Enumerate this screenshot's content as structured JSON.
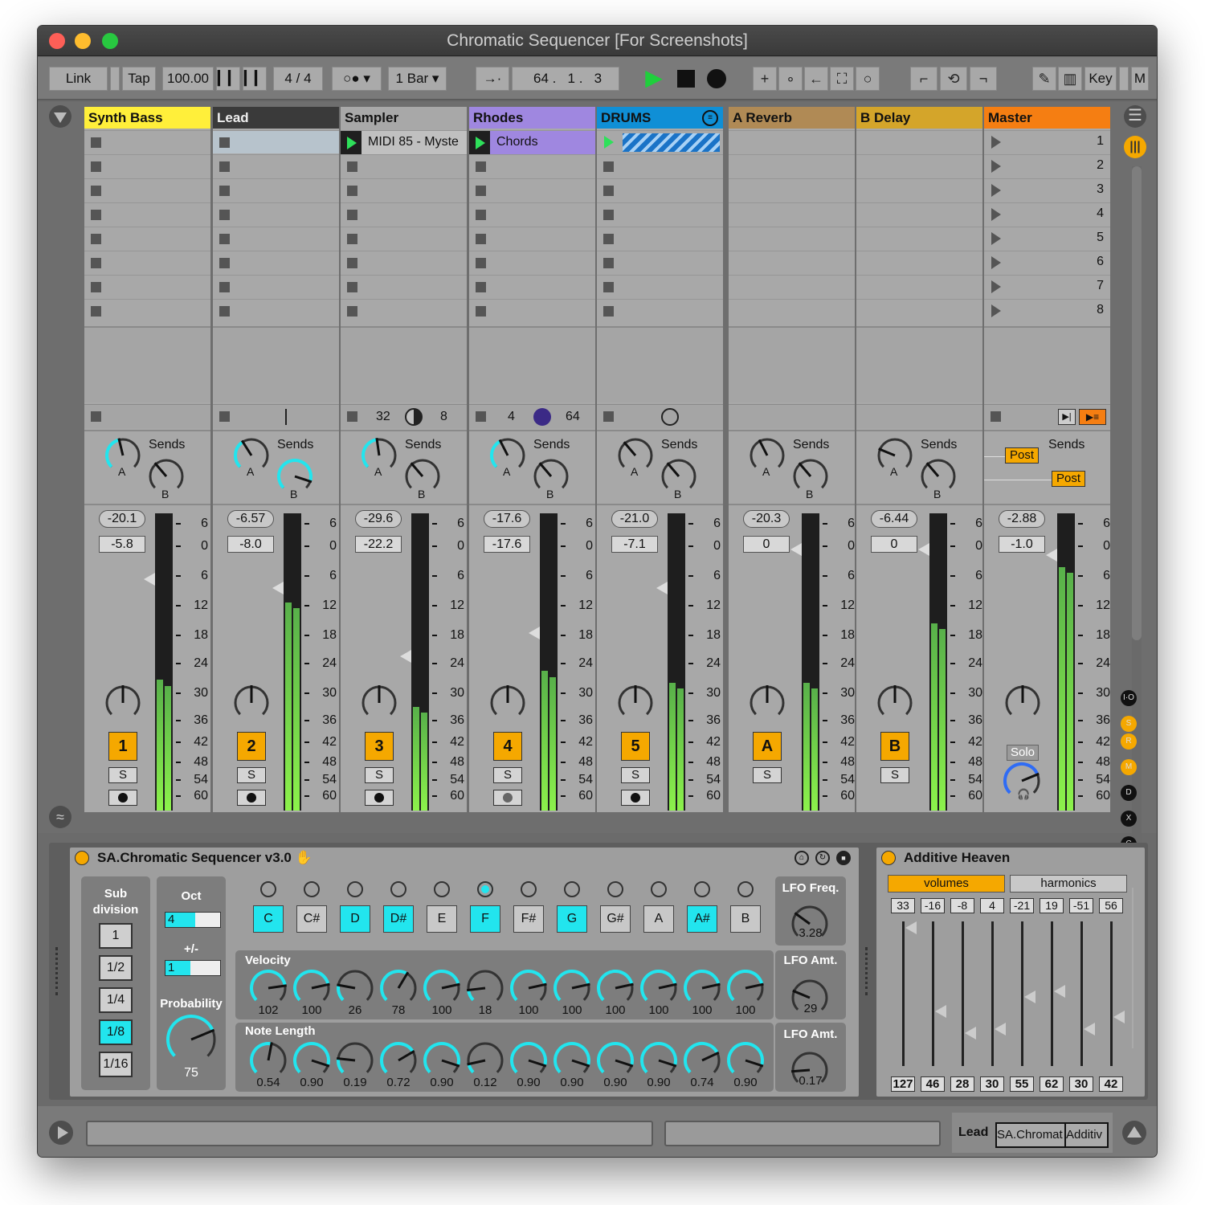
{
  "window": {
    "title": "Chromatic Sequencer  [For Screenshots]"
  },
  "control": {
    "link": "Link",
    "tap": "Tap",
    "tempo": "100.00",
    "sig_num": "4",
    "sig_slash": "/",
    "sig_den": "4",
    "quant": "1 Bar",
    "pos1": "64",
    "pos2": "1",
    "pos3": "3",
    "key": "Key",
    "m": "M"
  },
  "tracks": [
    {
      "name": "Synth Bass",
      "color": "#ffef3a",
      "vol": "-20.1",
      "pan": "-5.8",
      "num": "1",
      "solo": "S"
    },
    {
      "name": "Lead",
      "color": "#3a3a3a",
      "text": "#eeeeee",
      "vol": "-6.57",
      "pan": "-8.0",
      "num": "2",
      "solo": "S"
    },
    {
      "name": "Sampler",
      "color": "#a8a8a8",
      "vol": "-29.6",
      "pan": "-22.2",
      "num": "3",
      "solo": "S"
    },
    {
      "name": "Rhodes",
      "color": "#9f87e0",
      "vol": "-17.6",
      "pan": "-17.6",
      "num": "4",
      "solo": "S"
    },
    {
      "name": "DRUMS",
      "color": "#0f8fd6",
      "vol": "-21.0",
      "pan": "-7.1",
      "num": "5",
      "solo": "S"
    },
    {
      "name": "A Reverb",
      "color": "#b08a55",
      "vol": "-20.3",
      "pan": "0",
      "num": "A",
      "solo": "S"
    },
    {
      "name": "B Delay",
      "color": "#d4a52a",
      "vol": "-6.44",
      "pan": "0",
      "num": "B",
      "solo": "S"
    },
    {
      "name": "Master",
      "color": "#f57e12",
      "vol": "-2.88",
      "pan": "-1.0",
      "solo_label": "Solo"
    }
  ],
  "clips": {
    "sampler": "MIDI 85 - Myste",
    "rhodes": "Chords"
  },
  "scene_numbers": [
    "1",
    "2",
    "3",
    "4",
    "5",
    "6",
    "7",
    "8"
  ],
  "stop_row": {
    "sampler_a": "32",
    "sampler_b": "8",
    "rhodes_a": "4",
    "rhodes_b": "64"
  },
  "sends_label": "Sends",
  "send_letters": {
    "a": "A",
    "b": "B"
  },
  "master_post": "Post",
  "scale_labels": [
    "6",
    "0",
    "6",
    "12",
    "18",
    "24",
    "30",
    "36",
    "42",
    "48",
    "54",
    "60"
  ],
  "meter_levels": [
    0.44,
    0.7,
    0.35,
    0.47,
    0.43,
    0.43,
    0.63,
    0.82
  ],
  "sidebar_labels": [
    "I·O",
    "S",
    "R",
    "M",
    "D",
    "X",
    "C"
  ],
  "sequencer": {
    "title": "SA.Chromatic Sequencer v3.0",
    "subdivision_label": "Sub division",
    "subdivisions": [
      "1",
      "1/2",
      "1/4",
      "1/8",
      "1/16"
    ],
    "sub_selected": 3,
    "oct_label": "Oct",
    "oct_value": "4",
    "oct_fill": 0.55,
    "pm_label": "+/-",
    "pm_value": "1",
    "pm_fill": 0.45,
    "prob_label": "Probability",
    "prob_value": "75",
    "notes": [
      "C",
      "C#",
      "D",
      "D#",
      "E",
      "F",
      "F#",
      "G",
      "G#",
      "A",
      "A#",
      "B"
    ],
    "notes_on": [
      true,
      false,
      true,
      true,
      false,
      true,
      false,
      true,
      false,
      false,
      true,
      false
    ],
    "active_step": 5,
    "velocity_label": "Velocity",
    "velocity": [
      "102",
      "100",
      "26",
      "78",
      "100",
      "18",
      "100",
      "100",
      "100",
      "100",
      "100",
      "100"
    ],
    "notelen_label": "Note Length",
    "notelen": [
      "0.54",
      "0.90",
      "0.19",
      "0.72",
      "0.90",
      "0.12",
      "0.90",
      "0.90",
      "0.90",
      "0.90",
      "0.74",
      "0.90"
    ],
    "lfo_freq_label": "LFO Freq.",
    "lfo_freq": "3.28",
    "lfo_amt_label": "LFO Amt.",
    "lfo_amt1": "29",
    "lfo_amt2": "0.17"
  },
  "additive": {
    "title": "Additive Heaven",
    "tab_volumes": "volumes",
    "tab_harmonics": "harmonics",
    "top_values": [
      "33",
      "-16",
      "-8",
      "4",
      "-21",
      "19",
      "-51",
      "56"
    ],
    "bottom_values": [
      "127",
      "46",
      "28",
      "30",
      "55",
      "62",
      "30",
      "42"
    ]
  },
  "bottom": {
    "track": "Lead",
    "dev1": "SA.Chromat",
    "dev2": "Additiv"
  }
}
